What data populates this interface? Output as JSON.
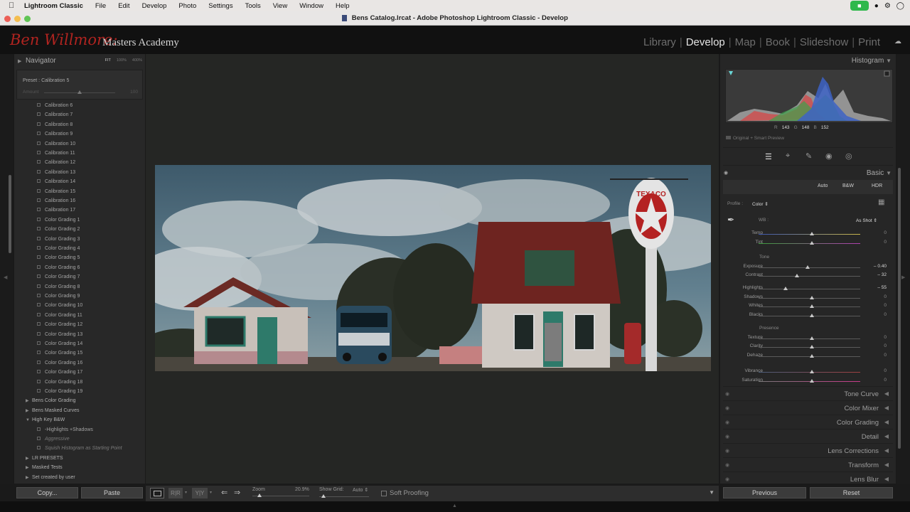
{
  "menubar": {
    "app_name": "Lightroom Classic",
    "items": [
      "File",
      "Edit",
      "Develop",
      "Photo",
      "Settings",
      "Tools",
      "View",
      "Window",
      "Help"
    ]
  },
  "titlebar": {
    "title": "Bens Catalog.lrcat - Adobe Photoshop Lightroom Classic - Develop"
  },
  "identity": {
    "script": "Ben Willmore:",
    "label": "Masters Academy"
  },
  "modules": [
    "Library",
    "Develop",
    "Map",
    "Book",
    "Slideshow",
    "Print"
  ],
  "active_module": "Develop",
  "navigator": {
    "title": "Navigator",
    "zoom_options": [
      "FIT",
      "100%",
      "400%"
    ],
    "preset_label": "Preset : Calibration 5",
    "amount_label": "Amount",
    "amount_value": "100"
  },
  "presets": {
    "items": [
      "Calibration 6",
      "Calibration 7",
      "Calibration 8",
      "Calibration 9",
      "Calibration 10",
      "Calibration 11",
      "Calibration 12",
      "Calibration 13",
      "Calibration 14",
      "Calibration 15",
      "Calibration 16",
      "Calibration 17",
      "Color Grading 1",
      "Color Grading 2",
      "Color Grading 3",
      "Color Grading 4",
      "Color Grading 5",
      "Color Grading 6",
      "Color Grading 7",
      "Color Grading 8",
      "Color Grading 9",
      "Color Grading 10",
      "Color Grading 11",
      "Color Grading 12",
      "Color Grading 13",
      "Color Grading 14",
      "Color Grading 15",
      "Color Grading 16",
      "Color Grading 17",
      "Color Grading 18",
      "Color Grading 19"
    ],
    "folders_a": [
      "Bens Color Grading",
      "Bens Masked Curves"
    ],
    "open_folder": "High Key B&W",
    "open_folder_items": [
      "-Highlights +Shadows",
      "Aggressive",
      "Squish Histogram as Starting Point"
    ],
    "folders_b": [
      "LR PRESETS",
      "Masked Tests",
      "Set created by user"
    ],
    "copy_label": "Copy...",
    "paste_label": "Paste"
  },
  "histogram": {
    "title": "Histogram",
    "r_label": "R",
    "r": "143",
    "g_label": "G",
    "g": "148",
    "b_label": "B",
    "b": "152",
    "preview_label": "Original + Smart Preview"
  },
  "basic": {
    "title": "Basic",
    "buttons": [
      "Auto",
      "B&W",
      "HDR"
    ],
    "profile_label": "Profile :",
    "profile_value": "Color",
    "wb_label": "WB :",
    "wb_value": "As Shot",
    "tone_label": "Tone",
    "presence_label": "Presence",
    "sliders": [
      {
        "label": "Temp",
        "value": "0"
      },
      {
        "label": "Tint",
        "value": "0"
      },
      {
        "label": "Exposure",
        "value": "– 0.40"
      },
      {
        "label": "Contrast",
        "value": "– 32"
      },
      {
        "label": "Highlights",
        "value": "– 55"
      },
      {
        "label": "Shadows",
        "value": "0"
      },
      {
        "label": "Whites",
        "value": "0"
      },
      {
        "label": "Blacks",
        "value": "0"
      },
      {
        "label": "Texture",
        "value": "0"
      },
      {
        "label": "Clarity",
        "value": "0"
      },
      {
        "label": "Dehaze",
        "value": "0"
      },
      {
        "label": "Vibrance",
        "value": "0"
      },
      {
        "label": "Saturation",
        "value": "0"
      }
    ]
  },
  "panels": [
    "Tone Curve",
    "Color Mixer",
    "Color Grading",
    "Detail",
    "Lens Corrections",
    "Transform",
    "Lens Blur"
  ],
  "right_buttons": {
    "previous": "Previous",
    "reset": "Reset"
  },
  "toolbar": {
    "zoom_label": "Zoom",
    "zoom_value": "20.9%",
    "grid_label": "Show Grid:",
    "grid_value": "Auto",
    "soft_proofing": "Soft Proofing"
  },
  "photo_sign": "TEXACO"
}
